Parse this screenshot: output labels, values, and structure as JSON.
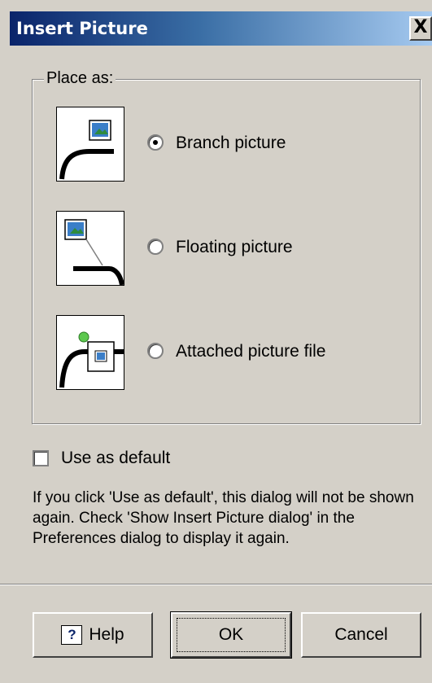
{
  "window": {
    "title": "Insert Picture",
    "close_label": "X"
  },
  "group": {
    "legend": "Place as:",
    "options": [
      {
        "label": "Branch picture",
        "checked": true,
        "icon": "branch-picture-icon"
      },
      {
        "label": "Floating picture",
        "checked": false,
        "icon": "floating-picture-icon"
      },
      {
        "label": "Attached picture file",
        "checked": false,
        "icon": "attached-picture-icon"
      }
    ]
  },
  "default_checkbox": {
    "label": "Use as default",
    "checked": false
  },
  "info": "If you click 'Use as default', this dialog will not be shown again. Check 'Show Insert Picture dialog' in the Preferences dialog to display it again.",
  "buttons": {
    "help": "Help",
    "help_icon": "?",
    "ok": "OK",
    "cancel": "Cancel"
  }
}
